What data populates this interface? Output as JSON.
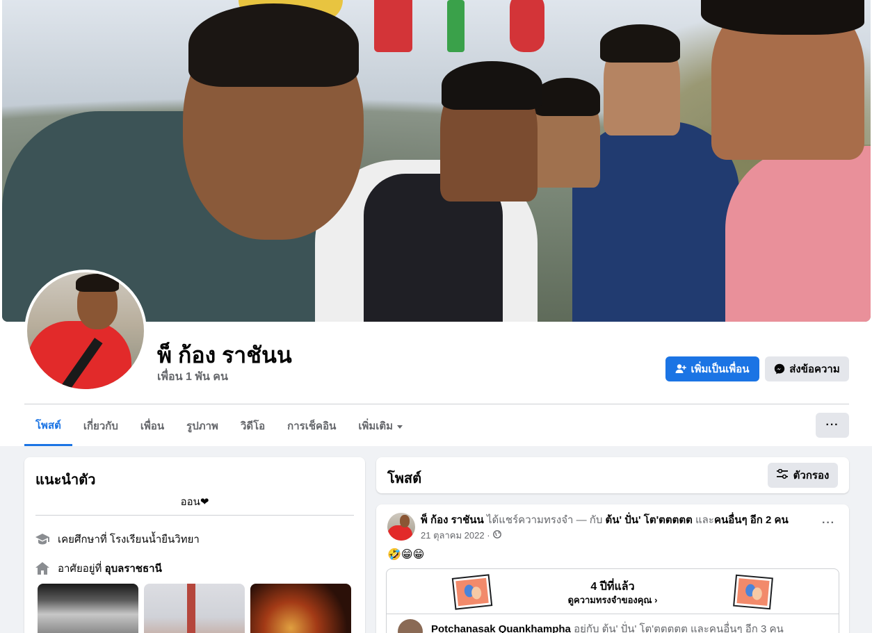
{
  "profile": {
    "name": "พ็ ก้อง ราชันน",
    "friends": "เพื่อน 1 พัน คน"
  },
  "actions": {
    "add_friend": "เพิ่มเป็นเพื่อน",
    "message": "ส่งข้อความ",
    "more": "···"
  },
  "tabs": [
    {
      "label": "โพสต์",
      "active": true
    },
    {
      "label": "เกี่ยวกับ"
    },
    {
      "label": "เพื่อน"
    },
    {
      "label": "รูปภาพ"
    },
    {
      "label": "วิดีโอ"
    },
    {
      "label": "การเช็คอิน"
    },
    {
      "label": "เพิ่มเติม"
    }
  ],
  "intro": {
    "title": "แนะนำตัว",
    "bio": "ออน❤",
    "school_prefix": "เคยศึกษาที่ โรงเรียนน้ำยืนวิทยา",
    "lives_prefix": "อาศัยอยู่ที่ ",
    "lives_place": "อุบลราชธานี"
  },
  "posts": {
    "title": "โพสต์",
    "filter": "ตัวกรอง"
  },
  "post": {
    "author": "พ็ ก้อง ราชันน",
    "action": " ได้แชร์ความทรงจำ — กับ ",
    "tagged": "ต้น' ปั่น' โต'ตตตตต",
    "and": " และ",
    "others": "คนอื่นๆ อีก 2 คน",
    "date": "21 ตุลาคม 2022 ·",
    "emoji": "🤣😁😁",
    "memory_title": "4 ปีที่แล้ว",
    "memory_sub": "ดูความทรงจำของคุณ ›",
    "next_author": "Potchanasak Quankhampha",
    "next_rest": " อยู่กับ ต้น' ปั่น' โต'ตตตตต และคนอื่นๆ อีก 3 คน"
  },
  "colors": {
    "accent": "#1b74e4",
    "secondary_btn": "#e4e6eb",
    "page_bg": "#f0f2f5"
  }
}
